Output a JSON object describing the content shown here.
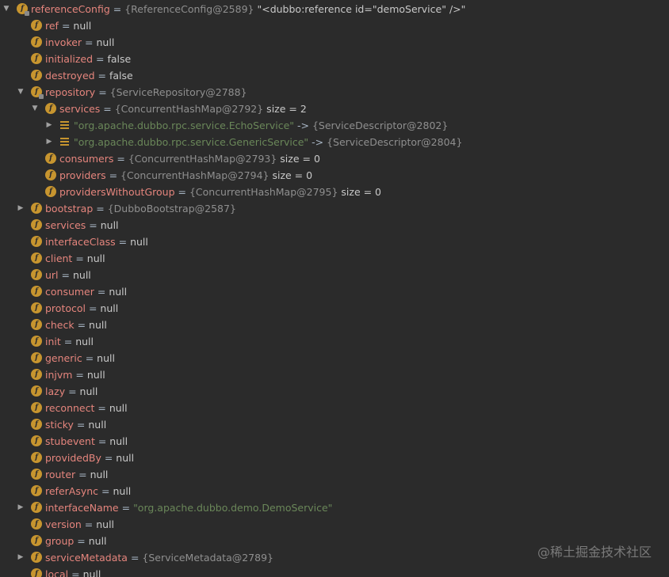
{
  "debug_tree": {
    "rows": [
      {
        "name": "referenceConfig",
        "eq": " = ",
        "ref": "{ReferenceConfig@2589}",
        "extra": " \"<dubbo:reference id=\"demoService\" />\""
      },
      {
        "name": "ref",
        "eq": " = ",
        "val": "null"
      },
      {
        "name": "invoker",
        "eq": " = ",
        "val": "null"
      },
      {
        "name": "initialized",
        "eq": " = ",
        "val": "false"
      },
      {
        "name": "destroyed",
        "eq": " = ",
        "val": "false"
      },
      {
        "name": "repository",
        "eq": " = ",
        "ref": "{ServiceRepository@2788}"
      },
      {
        "name": "services",
        "eq": " = ",
        "ref": "{ConcurrentHashMap@2792}",
        "extra": "  size = 2"
      },
      {
        "key": "\"org.apache.dubbo.rpc.service.EchoService\"",
        "arrow_sep": " -> ",
        "ref": "{ServiceDescriptor@2802}"
      },
      {
        "key": "\"org.apache.dubbo.rpc.service.GenericService\"",
        "arrow_sep": " -> ",
        "ref": "{ServiceDescriptor@2804}"
      },
      {
        "name": "consumers",
        "eq": " = ",
        "ref": "{ConcurrentHashMap@2793}",
        "extra": "  size = 0"
      },
      {
        "name": "providers",
        "eq": " = ",
        "ref": "{ConcurrentHashMap@2794}",
        "extra": "  size = 0"
      },
      {
        "name": "providersWithoutGroup",
        "eq": " = ",
        "ref": "{ConcurrentHashMap@2795}",
        "extra": "  size = 0"
      },
      {
        "name": "bootstrap",
        "eq": " = ",
        "ref": "{DubboBootstrap@2587}"
      },
      {
        "name": "services",
        "eq": " = ",
        "val": "null"
      },
      {
        "name": "interfaceClass",
        "eq": " = ",
        "val": "null"
      },
      {
        "name": "client",
        "eq": " = ",
        "val": "null"
      },
      {
        "name": "url",
        "eq": " = ",
        "val": "null"
      },
      {
        "name": "consumer",
        "eq": " = ",
        "val": "null"
      },
      {
        "name": "protocol",
        "eq": " = ",
        "val": "null"
      },
      {
        "name": "check",
        "eq": " = ",
        "val": "null"
      },
      {
        "name": "init",
        "eq": " = ",
        "val": "null"
      },
      {
        "name": "generic",
        "eq": " = ",
        "val": "null"
      },
      {
        "name": "injvm",
        "eq": " = ",
        "val": "null"
      },
      {
        "name": "lazy",
        "eq": " = ",
        "val": "null"
      },
      {
        "name": "reconnect",
        "eq": " = ",
        "val": "null"
      },
      {
        "name": "sticky",
        "eq": " = ",
        "val": "null"
      },
      {
        "name": "stubevent",
        "eq": " = ",
        "val": "null"
      },
      {
        "name": "providedBy",
        "eq": " = ",
        "val": "null"
      },
      {
        "name": "router",
        "eq": " = ",
        "val": "null"
      },
      {
        "name": "referAsync",
        "eq": " = ",
        "val": "null"
      },
      {
        "name": "interfaceName",
        "eq": " = ",
        "str": "\"org.apache.dubbo.demo.DemoService\""
      },
      {
        "name": "version",
        "eq": " = ",
        "val": "null"
      },
      {
        "name": "group",
        "eq": " = ",
        "val": "null"
      },
      {
        "name": "serviceMetadata",
        "eq": " = ",
        "ref": "{ServiceMetadata@2789}"
      },
      {
        "name": "local",
        "eq": " = ",
        "val": "null"
      }
    ]
  },
  "watermark": "@稀土掘金技术社区",
  "icons": {
    "field": "field-icon",
    "map_entry": "map-entry-icon",
    "expanded": "chevron-down-icon",
    "collapsed": "chevron-right-icon"
  },
  "colors": {
    "background": "#2b2b2b",
    "field_name": "#e5857d",
    "reference": "#8f8f8f",
    "string": "#6a8759",
    "icon": "#c7952f"
  }
}
